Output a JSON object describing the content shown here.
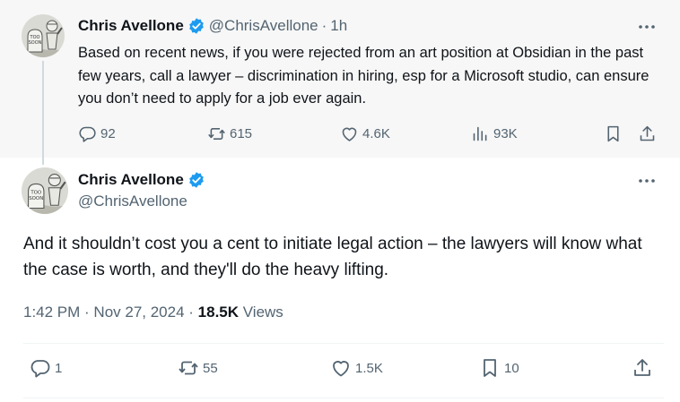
{
  "colors": {
    "text_primary": "#0f1419",
    "text_secondary": "#536471",
    "verified_blue": "#1d9bf0",
    "parent_bg": "#f7f7f7"
  },
  "parent_tweet": {
    "author_name": "Chris Avellone",
    "author_handle": "@ChrisAvellone",
    "separator": "·",
    "time_ago": "1h",
    "text": "Based on recent news, if you were rejected from an art position at Obsidian in the past few years, call a lawyer – discrimination in hiring, esp for a Microsoft studio, can ensure you don’t need to apply for a job ever again.",
    "replies": "92",
    "reposts": "615",
    "likes": "4.6K",
    "views": "93K",
    "icons": {
      "reply": "reply-icon",
      "repost": "repost-icon",
      "like": "heart-icon",
      "views": "views-icon",
      "bookmark": "bookmark-icon",
      "share": "share-icon",
      "more": "more-icon"
    }
  },
  "main_tweet": {
    "author_name": "Chris Avellone",
    "author_handle": "@ChrisAvellone",
    "text": "And it shouldn’t cost you a cent to initiate legal action – the lawyers will know what the case is worth, and they'll do the heavy lifting.",
    "time": "1:42 PM",
    "separator": " · ",
    "date": "Nov 27, 2024",
    "views_count": "18.5K",
    "views_label": " Views",
    "replies": "1",
    "reposts": "55",
    "likes": "1.5K",
    "bookmarks": "10"
  }
}
